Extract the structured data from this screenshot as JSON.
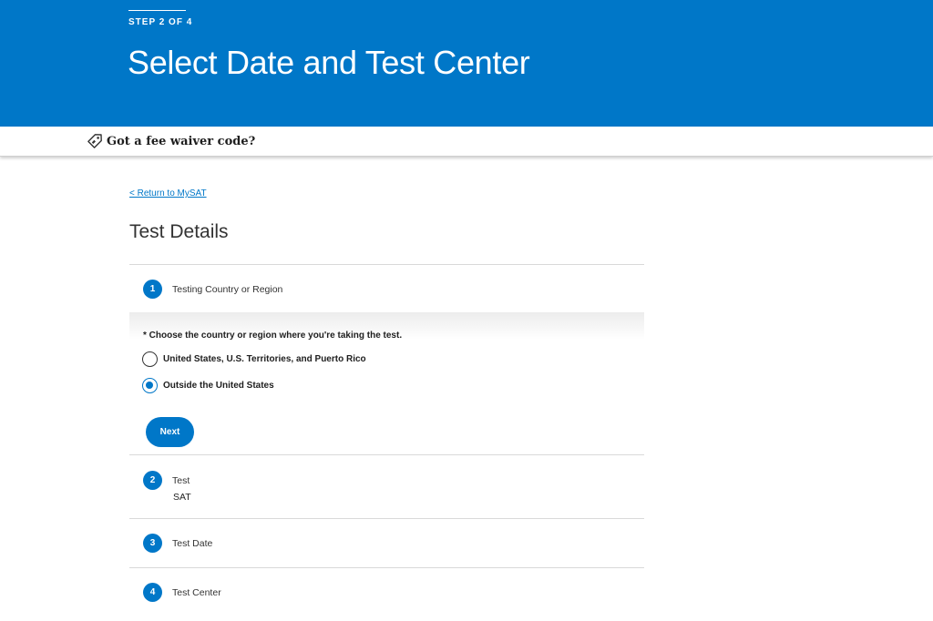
{
  "header": {
    "step_label": "STEP 2 OF 4",
    "title": "Select Date and Test Center"
  },
  "fee_waiver": {
    "icon": "tag-icon",
    "label": "Got a fee waiver code?"
  },
  "return_link": "< Return to MySAT",
  "section_title": "Test Details",
  "steps": [
    {
      "number": "1",
      "name": "Testing Country or Region",
      "value": ""
    },
    {
      "number": "2",
      "name": "Test",
      "value": "SAT"
    },
    {
      "number": "3",
      "name": "Test Date",
      "value": ""
    },
    {
      "number": "4",
      "name": "Test Center",
      "value": ""
    }
  ],
  "country_panel": {
    "prompt": "* Choose the country or region where you're taking the test.",
    "options": [
      {
        "label": "United States, U.S. Territories, and Puerto Rico",
        "selected": false
      },
      {
        "label": "Outside the United States",
        "selected": true
      }
    ],
    "next_label": "Next"
  },
  "colors": {
    "brand_blue": "#0077c8",
    "text": "#1e1e1e",
    "divider": "#d9d9d9"
  }
}
